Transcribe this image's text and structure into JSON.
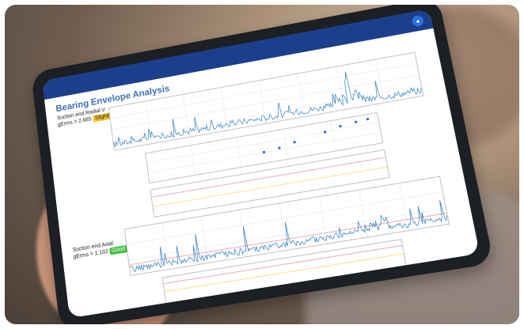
{
  "screen": {
    "title": "Bearing Envelope Analysis",
    "sections": [
      {
        "name": "Suction end Radial V",
        "grms_text": "gErms = 2.685",
        "status": "Slightly Rough",
        "status_color": "#f4c430"
      },
      {
        "name": "Suction end Axial",
        "grms_text": "gErms = 1.102",
        "status": "Good",
        "status_color": "#3fbf3f"
      }
    ]
  },
  "colors": {
    "topbar": "#1c3f8c",
    "title": "#3d6fb8",
    "trace": "#2b7bbd",
    "points": "#2b6fd1",
    "threshold": "#e05b5b"
  },
  "icons": {
    "topbar_avatar": "user-circle-icon"
  }
}
